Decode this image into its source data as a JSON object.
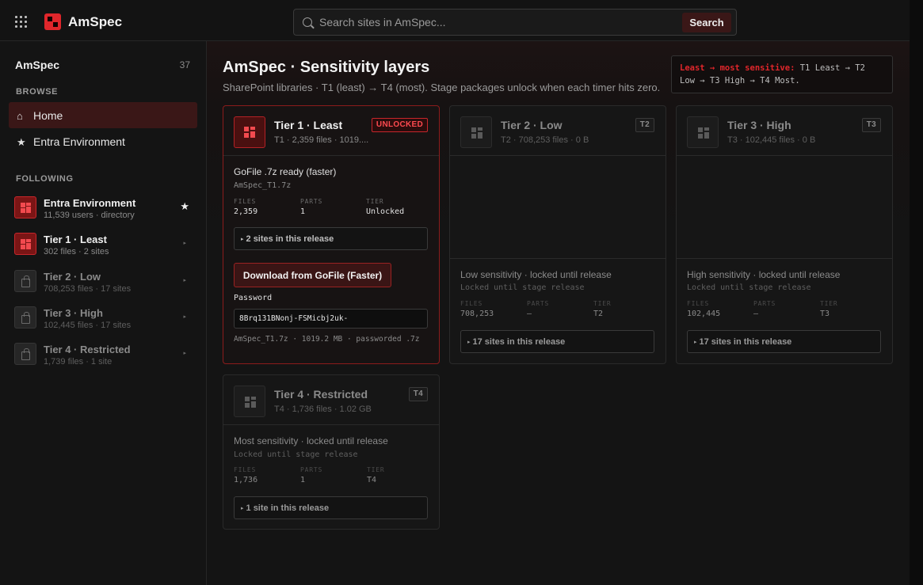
{
  "app": {
    "brand": "AmSpec"
  },
  "search": {
    "placeholder": "Search sites in AmSpec...",
    "button": "Search"
  },
  "sidebar": {
    "title": "AmSpec",
    "count": "37",
    "browse_heading": "BROWSE",
    "browse": [
      {
        "label": "Home",
        "icon": "home-icon",
        "active": true
      },
      {
        "label": "Entra Environment",
        "icon": "star-icon",
        "active": false
      }
    ],
    "following_heading": "FOLLOWING",
    "following": [
      {
        "name": "Entra Environment",
        "sub": "11,539 users · directory",
        "marker": "★",
        "style": "red"
      },
      {
        "name": "Tier 1 · Least",
        "sub": "302 files · 2 sites",
        "marker": "▸",
        "style": "red"
      },
      {
        "name": "Tier 2 · Low",
        "sub": "708,253 files · 17 sites",
        "marker": "▸",
        "style": "gray"
      },
      {
        "name": "Tier 3 · High",
        "sub": "102,445 files · 17 sites",
        "marker": "▸",
        "style": "gray"
      },
      {
        "name": "Tier 4 · Restricted",
        "sub": "1,739 files · 1 site",
        "marker": "▸",
        "style": "gray"
      }
    ]
  },
  "main": {
    "title": "AmSpec · Sensitivity layers",
    "subtitle": "SharePoint libraries · T1 (least) → T4 (most). Stage packages unlock when each timer hits zero.",
    "legend": {
      "lead": "Least → most sensitive:",
      "text": " T1 Least → T2 Low → T3 High → T4 Most."
    }
  },
  "tiers": [
    {
      "name": "Tier 1 · Least",
      "meta": "T1 · 2,359 files · 1019....",
      "badge": "UNLOCKED",
      "status": "GoFile .7z ready (faster)",
      "file": "AmSpec_T1.7z",
      "stats": {
        "files_label": "FILES",
        "files": "2,359",
        "parts_label": "PARTS",
        "parts": "1",
        "tier_label": "TIER",
        "tier": "Unlocked"
      },
      "sites": "2 sites in this release",
      "download": "Download from GoFile (Faster)",
      "password_label": "Password",
      "password": "8Brq131BNonj-FSMicbj2uk-",
      "footer": "AmSpec_T1.7z · 1019.2 MB · passworded .7z"
    },
    {
      "name": "Tier 2 · Low",
      "meta": "T2 · 708,253 files · 0 B",
      "badge": "T2",
      "status": "Low sensitivity · locked until release",
      "file": "Locked until stage release",
      "stats": {
        "files_label": "FILES",
        "files": "708,253",
        "parts_label": "PARTS",
        "parts": "—",
        "tier_label": "TIER",
        "tier": "T2"
      },
      "sites": "17 sites in this release"
    },
    {
      "name": "Tier 3 · High",
      "meta": "T3 · 102,445 files · 0 B",
      "badge": "T3",
      "status": "High sensitivity · locked until release",
      "file": "Locked until stage release",
      "stats": {
        "files_label": "FILES",
        "files": "102,445",
        "parts_label": "PARTS",
        "parts": "—",
        "tier_label": "TIER",
        "tier": "T3"
      },
      "sites": "17 sites in this release"
    },
    {
      "name": "Tier 4 · Restricted",
      "meta": "T4 · 1,736 files · 1.02 GB",
      "badge": "T4",
      "status": "Most sensitivity · locked until release",
      "file": "Locked until stage release",
      "stats": {
        "files_label": "FILES",
        "files": "1,736",
        "parts_label": "PARTS",
        "parts": "1",
        "tier_label": "TIER",
        "tier": "T4"
      },
      "sites": "1 site in this release"
    }
  ],
  "colors": {
    "accent": "#e0262b",
    "active_bg": "#3a1717",
    "background": "#121212"
  }
}
